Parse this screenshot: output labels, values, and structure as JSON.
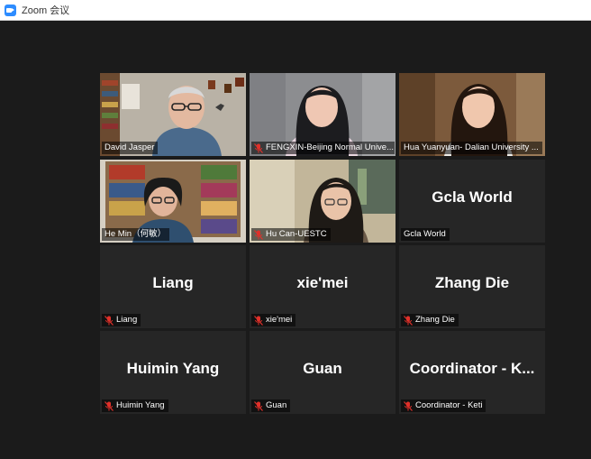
{
  "window": {
    "title": "Zoom 会议"
  },
  "colors": {
    "active_speaker_border": "#c7e24a",
    "mute_icon": "#e0302a",
    "tile_bg": "#262626"
  },
  "participants": [
    {
      "name": "David Jasper",
      "muted": false,
      "video": true,
      "active": true
    },
    {
      "name": "FENGXIN-Beijing Normal Unive...",
      "muted": true,
      "video": true
    },
    {
      "name": "Hua Yuanyuan- Dalian University ...",
      "muted": false,
      "video": true
    },
    {
      "name": "He Min（何敏）",
      "muted": false,
      "video": true
    },
    {
      "name": "Hu Can-UESTC",
      "muted": true,
      "video": true
    },
    {
      "name": "Gcla World",
      "display": "Gcla World",
      "muted": false,
      "video": false
    },
    {
      "name": "Liang",
      "display": "Liang",
      "muted": true,
      "video": false
    },
    {
      "name": "xie'mei",
      "display": "xie'mei",
      "muted": true,
      "video": false
    },
    {
      "name": "Zhang Die",
      "display": "Zhang Die",
      "muted": true,
      "video": false
    },
    {
      "name": "Huimin Yang",
      "display": "Huimin Yang",
      "muted": true,
      "video": false
    },
    {
      "name": "Guan",
      "display": "Guan",
      "muted": true,
      "video": false
    },
    {
      "name": "Coordinator - Keti",
      "display": "Coordinator  -  K...",
      "muted": true,
      "video": false
    }
  ]
}
